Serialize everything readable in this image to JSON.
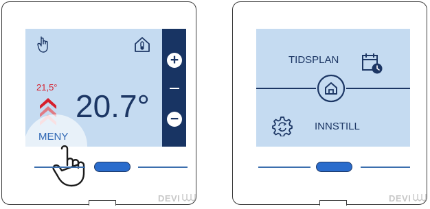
{
  "screen1": {
    "setpoint": "21,5°",
    "temperature": "20.7°",
    "menu_label": "MENY",
    "plus_label": "+",
    "minus_label": "−"
  },
  "screen2": {
    "schedule_label": "TIDSPLAN",
    "settings_label": "INNSTILL"
  },
  "brand": "DEVI",
  "colors": {
    "screen_bg": "#c5dbf1",
    "dark_blue": "#183463",
    "setpoint_red": "#d61f2c",
    "menu_blue": "#2f67b4",
    "pill_blue": "#2a6ccc"
  },
  "icons": [
    "hand-pointer-icon",
    "house-thermometer-icon",
    "chevron-up-icon",
    "hand-cursor-icon",
    "calendar-clock-icon",
    "home-icon",
    "gear-refresh-icon",
    "devi-mark-icon"
  ]
}
